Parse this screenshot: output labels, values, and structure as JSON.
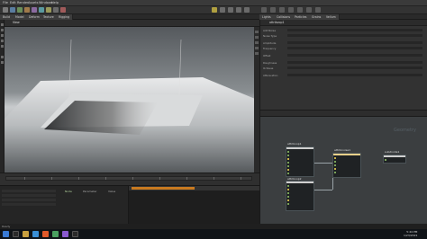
{
  "menubar": {
    "items": [
      "File",
      "Edit",
      "Render",
      "Assets",
      "Windows",
      "Help"
    ]
  },
  "tabs": [
    "Build",
    "Model",
    "Deform",
    "Texture",
    "Rigging",
    "Characters",
    "Animate",
    "Hair",
    "Terrain",
    "Simple FX",
    "Cloud FX",
    "Volume",
    "Lights",
    "Collisions",
    "Particles",
    "Grains",
    "Vellum"
  ],
  "viewport": {
    "view_label": "View",
    "persp_label": "Persp"
  },
  "param_panel": {
    "title": "attribvop1",
    "rows": [
      "Add Noise",
      "Noise Type",
      "Amplitude",
      "Frequency",
      "Offset",
      "Roughness",
      "Octaves",
      "Attenuation"
    ]
  },
  "nodegraph": {
    "watermark": "Geometry",
    "nodes": [
      {
        "title": "attribvop1",
        "color": "#cfcfcf"
      },
      {
        "title": "attribvop2",
        "color": "#cfcfcf"
      },
      {
        "title": "attribnoise1",
        "color": "#e8d08a"
      },
      {
        "title": "subdivide1",
        "color": "#cfcfcf"
      }
    ]
  },
  "bottom": {
    "labels": [
      "Node",
      "Parameter",
      "Value"
    ]
  },
  "status": {
    "text": "Ready"
  },
  "taskbar": {
    "time": "5:44 PM",
    "date": "1/23/2021"
  },
  "colors": {
    "accent": "#c87a20",
    "port_green": "#7aa35a",
    "port_yellow": "#c8b04a"
  }
}
